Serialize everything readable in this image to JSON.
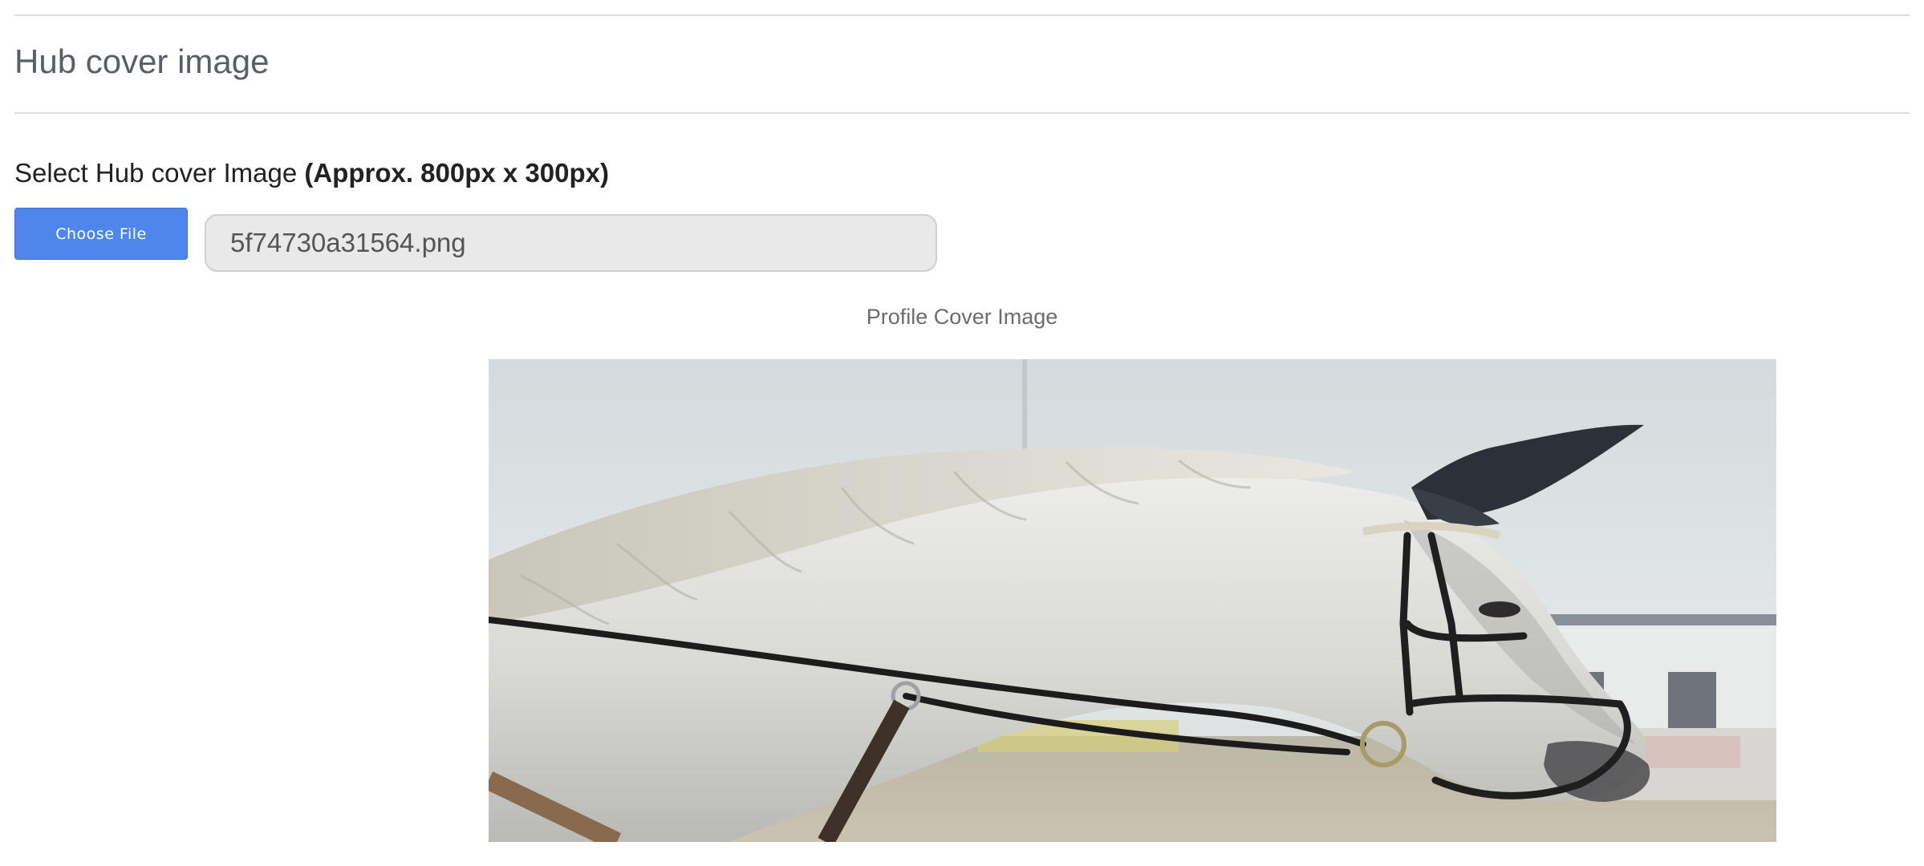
{
  "section": {
    "title": "Hub cover image"
  },
  "upload": {
    "label_prefix": "Select Hub cover Image ",
    "label_emphasis": "(Approx. 800px x 300px)",
    "choose_button": "Choose File",
    "filename": "5f74730a31564.png"
  },
  "preview": {
    "caption": "Profile Cover Image",
    "subject": "white horse wearing bridle and ear bonnet"
  },
  "colors": {
    "accent": "#4f86ec",
    "title_text": "#5a5f66",
    "input_bg": "#e9e9e9"
  }
}
